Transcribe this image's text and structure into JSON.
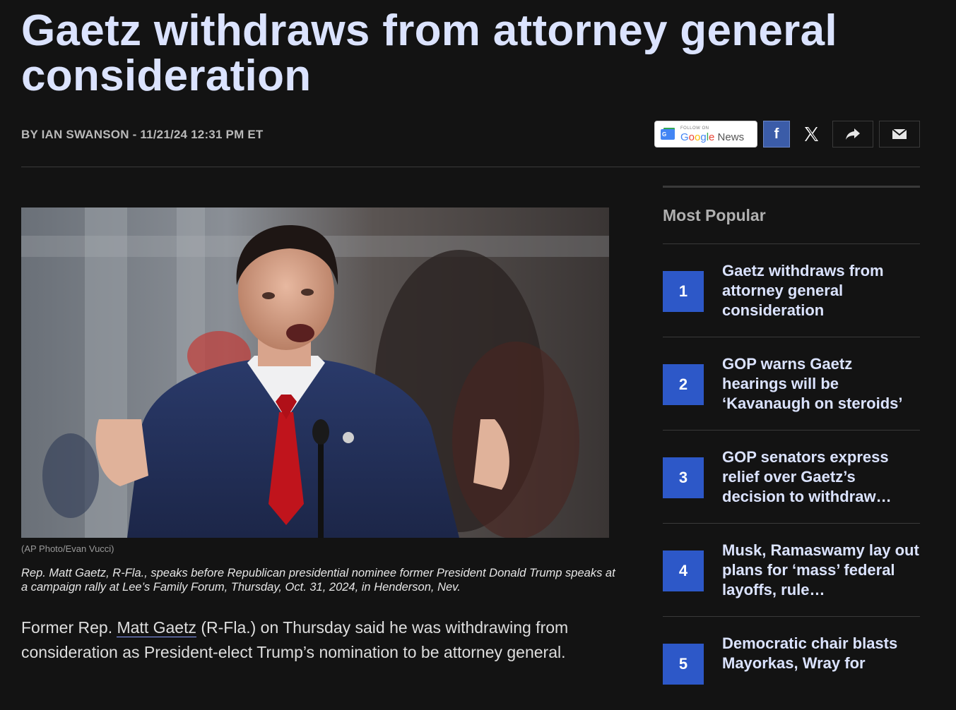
{
  "article": {
    "headline": "Gaetz withdraws from attorney general consideration",
    "byline": "BY IAN SWANSON - 11/21/24 12:31 PM ET",
    "photo_credit": "(AP Photo/Evan Vucci)",
    "caption": "Rep. Matt Gaetz, R-Fla., speaks before Republican presidential nominee former President Donald Trump speaks at a campaign rally at Lee’s Family Forum, Thursday, Oct. 31, 2024, in Henderson, Nev.",
    "body_before": "Former Rep. ",
    "body_link": "Matt Gaetz",
    "body_after": " (R-Fla.) on Thursday said he was withdrawing from consideration as President-elect Trump’s nomination to be attorney general."
  },
  "share": {
    "google_news_small": "FOLLOW ON",
    "google_news_label": "Google News",
    "facebook_label": "f",
    "icons": [
      "google-news-icon",
      "facebook-icon",
      "x-icon",
      "share-arrow-icon",
      "email-icon"
    ],
    "facebook_color": "#3b5ca8"
  },
  "sidebar": {
    "title": "Most Popular",
    "items": [
      {
        "num": "1",
        "title": "Gaetz withdraws from attorney general consideration"
      },
      {
        "num": "2",
        "title": "GOP warns Gaetz hearings will be ‘Kavanaugh on steroids’"
      },
      {
        "num": "3",
        "title": "GOP senators express relief over Gaetz’s decision to withdraw…"
      },
      {
        "num": "4",
        "title": "Musk, Ramaswamy lay out plans for ‘mass’ federal layoffs, rule…"
      },
      {
        "num": "5",
        "title": "Democratic chair blasts Mayorkas, Wray for"
      }
    ],
    "accent_color": "#2d58c8"
  }
}
